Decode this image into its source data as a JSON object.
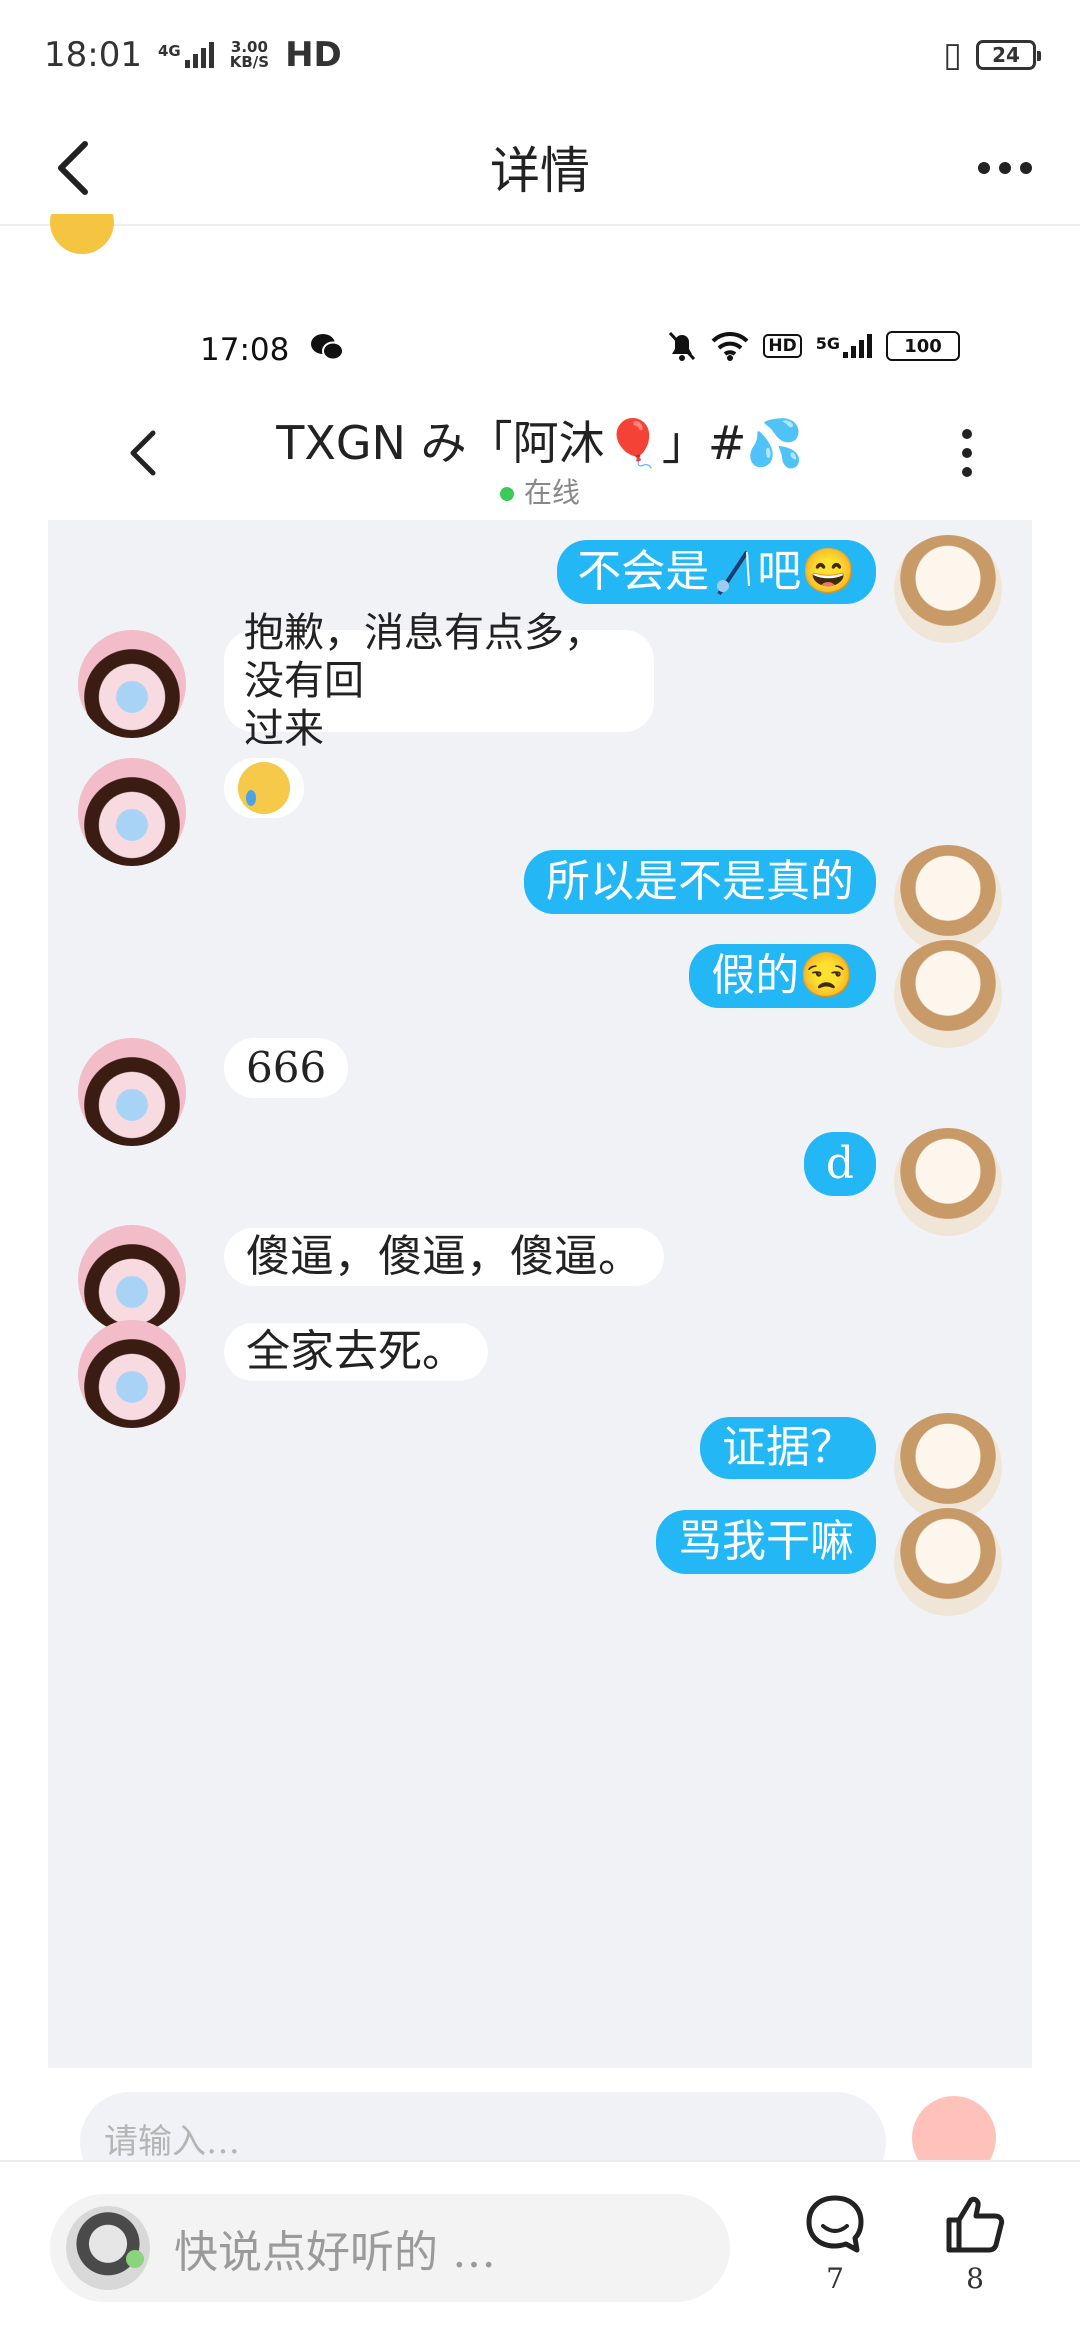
{
  "status_bar": {
    "time": "18:01",
    "network": "4G",
    "speed_value": "3.00",
    "speed_unit": "KB/S",
    "hd": "HD",
    "battery": "24"
  },
  "header": {
    "title": "详情"
  },
  "screenshot": {
    "status_bar": {
      "time": "17:08",
      "hd": "HD",
      "network": "5G",
      "battery": "100"
    },
    "chat_header": {
      "title": "TXGN み「阿沐🎈」#💦",
      "status": "在线"
    },
    "messages": [
      {
        "sender": "me",
        "text_before": "不会是",
        "text_after": "吧😄"
      },
      {
        "sender": "them",
        "text_line1": "抱歉，消息有点多，没有回",
        "text_line2": "过来"
      },
      {
        "sender": "them",
        "emoji": "crying-face"
      },
      {
        "sender": "me",
        "text": "所以是不是真的"
      },
      {
        "sender": "me",
        "text": "假的😒"
      },
      {
        "sender": "them",
        "text": "666"
      },
      {
        "sender": "me",
        "text": "d"
      },
      {
        "sender": "them",
        "text": "傻逼，傻逼，傻逼。"
      },
      {
        "sender": "them",
        "text": "全家去死。"
      },
      {
        "sender": "me",
        "text": "证据？"
      },
      {
        "sender": "me",
        "text": "骂我干嘛"
      }
    ],
    "input": {
      "placeholder": "请输入…"
    }
  },
  "bottom_bar": {
    "comment_placeholder": "快说点好听的 …",
    "comment_count": "7",
    "like_count": "8"
  },
  "colors": {
    "self_bubble": "#23b7f6",
    "other_bubble": "#ffffff",
    "chat_background": "#f1f2f5",
    "online_dot": "#3bcb5a"
  }
}
